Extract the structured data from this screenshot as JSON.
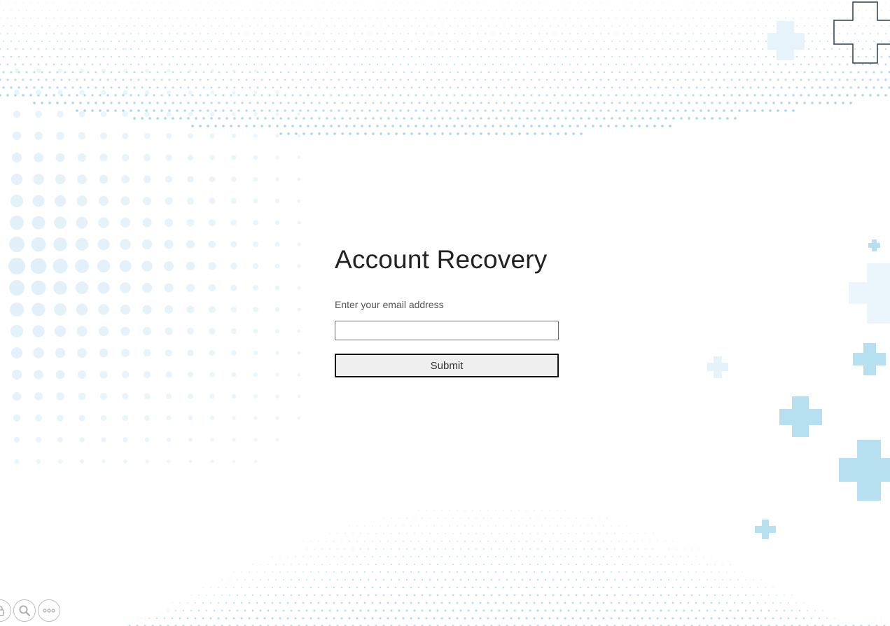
{
  "page": {
    "title": "Account Recovery"
  },
  "form": {
    "email_label": "Enter your email address",
    "email_value": "",
    "email_placeholder": "",
    "submit_label": "Submit"
  },
  "toolbar": {
    "buttons": [
      {
        "icon": "lock-icon"
      },
      {
        "icon": "search-icon"
      },
      {
        "icon": "more-icon"
      }
    ]
  },
  "theme": {
    "dot_color": "#8fcbe6",
    "light_dot_color": "#dcedf8",
    "cross_color": "#b6dff0",
    "cross_outline": "#2b3d52",
    "text_color": "#222222"
  }
}
